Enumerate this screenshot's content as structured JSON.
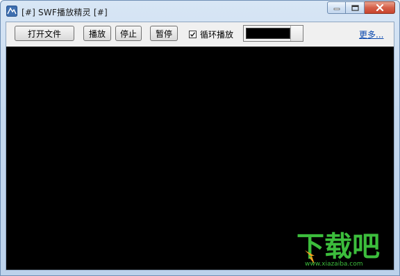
{
  "window": {
    "title": "[#] SWF播放精灵 [#]",
    "icon": "app-swf-icon"
  },
  "caption": {
    "minimize_icon": "minimize-icon",
    "maximize_icon": "maximize-icon",
    "close_icon": "close-icon"
  },
  "toolbar": {
    "open_label": "打开文件",
    "play_label": "播放",
    "stop_label": "停止",
    "pause_label": "暂停",
    "loop_label": "循环播放",
    "loop_checked": true,
    "bg_color": "#000000",
    "more_label": "更多..."
  },
  "player": {
    "background": "#000000"
  },
  "watermark": {
    "text": "下载吧",
    "url": "www.xiazaiba.com",
    "color": "#3cbd3c"
  }
}
